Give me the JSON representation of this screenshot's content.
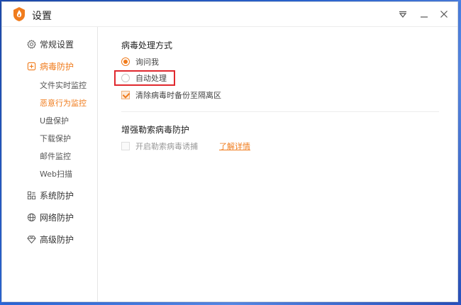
{
  "window": {
    "title": "设置",
    "brand_color": "#f07c1d",
    "controls": {
      "menu_icon": "dropdown-triangle-icon",
      "minimize_icon": "minimize-icon",
      "close_icon": "close-icon"
    }
  },
  "sidebar": {
    "items": [
      {
        "id": "general",
        "label": "常规设置",
        "icon": "gear-icon",
        "active": false
      },
      {
        "id": "virus",
        "label": "病毒防护",
        "icon": "plus-square-icon",
        "active": true,
        "children": [
          {
            "label": "文件实时监控",
            "active": false
          },
          {
            "label": "恶意行为监控",
            "active": true
          },
          {
            "label": "U盘保护",
            "active": false
          },
          {
            "label": "下载保护",
            "active": false
          },
          {
            "label": "邮件监控",
            "active": false
          },
          {
            "label": "Web扫描",
            "active": false
          }
        ]
      },
      {
        "id": "system",
        "label": "系统防护",
        "icon": "grid-icon",
        "active": false
      },
      {
        "id": "network",
        "label": "网络防护",
        "icon": "globe-icon",
        "active": false
      },
      {
        "id": "advanced",
        "label": "高级防护",
        "icon": "diamond-icon",
        "active": false
      }
    ]
  },
  "main": {
    "virus_handling": {
      "title": "病毒处理方式",
      "options": [
        {
          "label": "询问我",
          "selected": true
        },
        {
          "label": "自动处理",
          "selected": false
        }
      ],
      "backup_checkbox": {
        "label": "清除病毒时备份至隔离区",
        "checked": true
      }
    },
    "ransomware": {
      "title": "增强勒索病毒防护",
      "trap_checkbox": {
        "label": "开启勒索病毒诱捕",
        "checked": false
      },
      "details_link": "了解详情"
    }
  }
}
